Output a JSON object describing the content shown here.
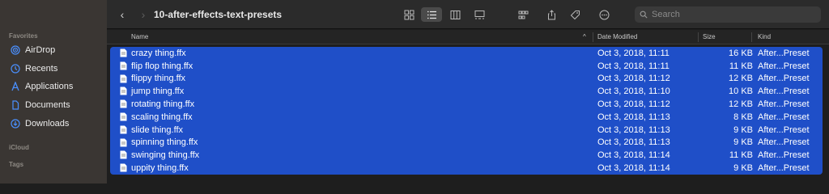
{
  "window": {
    "title": "10-after-effects-text-presets"
  },
  "sidebar": {
    "favorites_label": "Favorites",
    "items": [
      {
        "label": "AirDrop",
        "icon": "airdrop-icon"
      },
      {
        "label": "Recents",
        "icon": "clock-icon"
      },
      {
        "label": "Applications",
        "icon": "applications-icon"
      },
      {
        "label": "Documents",
        "icon": "document-icon"
      },
      {
        "label": "Downloads",
        "icon": "download-icon"
      }
    ],
    "icloud_label": "iCloud",
    "tags_label": "Tags"
  },
  "toolbar": {
    "back": "‹",
    "forward": "›",
    "search_placeholder": "Search"
  },
  "columns": {
    "name": "Name",
    "date": "Date Modified",
    "size": "Size",
    "kind": "Kind",
    "sort_indicator": "^"
  },
  "files": [
    {
      "name": "crazy thing.ffx",
      "date": "Oct 3, 2018, 11:11",
      "size": "16 KB",
      "kind": "After...Preset"
    },
    {
      "name": "flip flop thing.ffx",
      "date": "Oct 3, 2018, 11:11",
      "size": "11 KB",
      "kind": "After...Preset"
    },
    {
      "name": "flippy thing.ffx",
      "date": "Oct 3, 2018, 11:12",
      "size": "12 KB",
      "kind": "After...Preset"
    },
    {
      "name": "jump thing.ffx",
      "date": "Oct 3, 2018, 11:10",
      "size": "10 KB",
      "kind": "After...Preset"
    },
    {
      "name": "rotating thing.ffx",
      "date": "Oct 3, 2018, 11:12",
      "size": "12 KB",
      "kind": "After...Preset"
    },
    {
      "name": "scaling thing.ffx",
      "date": "Oct 3, 2018, 11:13",
      "size": "8 KB",
      "kind": "After...Preset"
    },
    {
      "name": "slide thing.ffx",
      "date": "Oct 3, 2018, 11:13",
      "size": "9 KB",
      "kind": "After...Preset"
    },
    {
      "name": "spinning thing.ffx",
      "date": "Oct 3, 2018, 11:13",
      "size": "9 KB",
      "kind": "After...Preset"
    },
    {
      "name": "swinging thing.ffx",
      "date": "Oct 3, 2018, 11:14",
      "size": "11 KB",
      "kind": "After...Preset"
    },
    {
      "name": "uppity thing.ffx",
      "date": "Oct 3, 2018, 11:14",
      "size": "9 KB",
      "kind": "After...Preset"
    }
  ],
  "colors": {
    "selection": "#1f4fc8",
    "sidebar_bg": "#3a3633",
    "accent_icon": "#4a90ff"
  }
}
